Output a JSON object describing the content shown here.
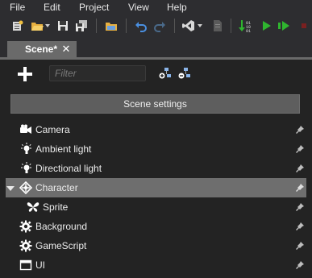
{
  "menubar": {
    "items": [
      "File",
      "Edit",
      "Project",
      "View",
      "Help"
    ]
  },
  "toolbar": {
    "icons": [
      "new-project-icon",
      "open-folder-icon",
      "save-icon",
      "save-all-icon",
      "browse-folder-icon",
      "undo-icon",
      "redo-icon",
      "visual-studio-icon",
      "script-page-icon",
      "build-icon",
      "play-icon",
      "debug-play-icon",
      "stop-icon"
    ]
  },
  "tab": {
    "label": "Scene*",
    "close": "✕"
  },
  "filter": {
    "placeholder": "Filter"
  },
  "scene_settings": {
    "label": "Scene settings"
  },
  "tree": {
    "items": [
      {
        "label": "Camera",
        "icon": "camera-icon",
        "selected": false
      },
      {
        "label": "Ambient light",
        "icon": "light-bulb-icon",
        "selected": false
      },
      {
        "label": "Directional light",
        "icon": "light-bulb-icon",
        "selected": false
      },
      {
        "label": "Character",
        "icon": "entity-icon",
        "selected": true,
        "expanded": true
      },
      {
        "label": "Sprite",
        "icon": "butterfly-icon",
        "selected": false
      },
      {
        "label": "Background",
        "icon": "gear-icon",
        "selected": false
      },
      {
        "label": "GameScript",
        "icon": "gear-icon",
        "selected": false
      },
      {
        "label": "UI",
        "icon": "window-icon",
        "selected": false
      }
    ]
  },
  "colors": {
    "selected_row": "#6e6e6e",
    "tab_active": "#6a6a6a",
    "play_green": "#2fb52f"
  }
}
